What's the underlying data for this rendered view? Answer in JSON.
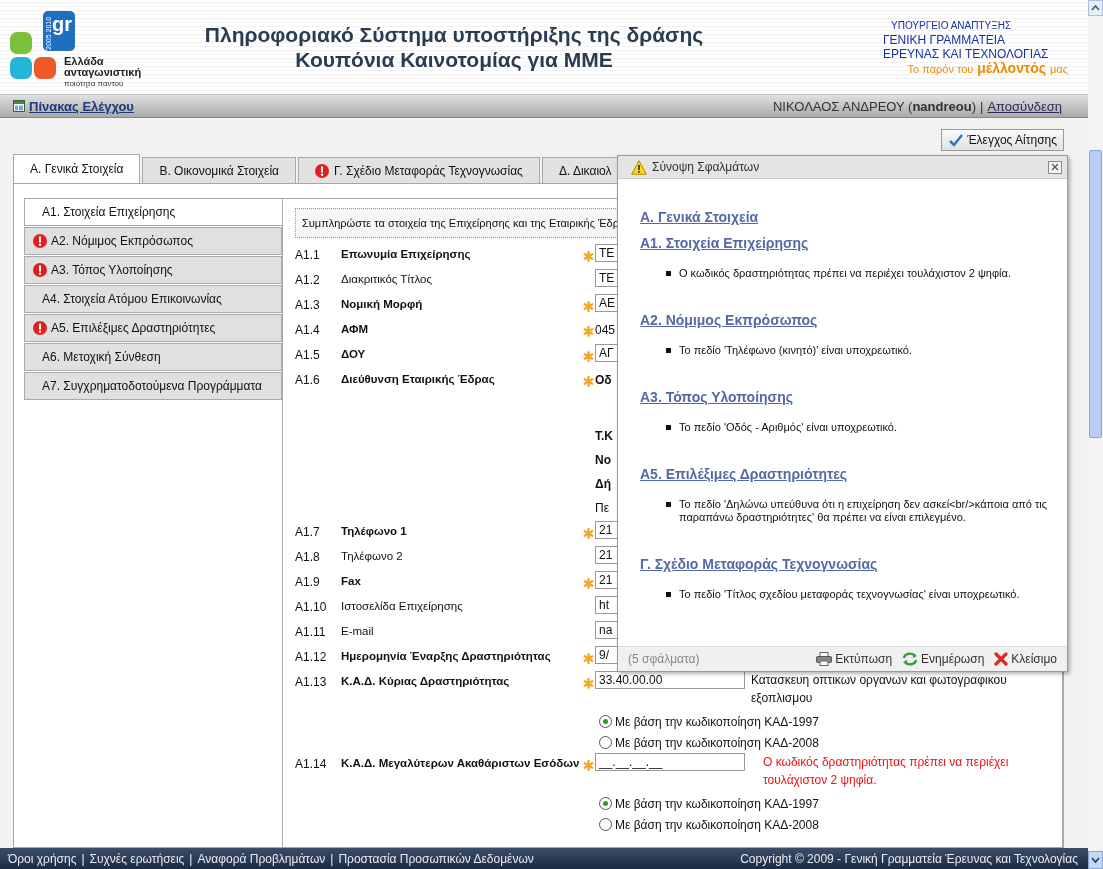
{
  "header": {
    "logo": {
      "mark": "gr",
      "years": "2005 2010",
      "lines": [
        "Ελλάδα",
        "ανταγωνιστική"
      ],
      "tagline": "ποιότητα παντού"
    },
    "title_lines": [
      "Πληροφοριακό Σύστημα υποστήριξης της δράσης",
      "Κουπόνια Καινοτομίας για ΜΜΕ"
    ],
    "ministry_lines": [
      "ΥΠΟΥΡΓΕΙΟ ΑΝΑΠΤΥΞΗΣ",
      "ΓΕΝΙΚΗ ΓΡΑΜΜΑΤΕΙΑ",
      "ΕΡΕΥΝΑΣ ΚΑΙ ΤΕΧΝΟΛΟΓΙΑΣ"
    ],
    "slogan": {
      "before": "Το παρόν του",
      "emphasis": "μέλλοντός",
      "after": "μας"
    }
  },
  "nav": {
    "dashboard_link": "Πίνακας Ελέγχου",
    "user": "ΝΙΚΟΛΑΟΣ ΑΝΔΡΕΟΥ (**nandreou**)",
    "separator": "|",
    "logout_link": "Αποσύνδεση"
  },
  "check_button": "Έλεγχος Αίτησης",
  "tabs": [
    {
      "label": "Α. Γενικά Στοιχεία",
      "selected": true,
      "error": false
    },
    {
      "label": "Β. Οικονομικά Στοιχεία",
      "selected": false,
      "error": false
    },
    {
      "label": "Γ. Σχέδιο Μεταφοράς Τεχνογνωσίας",
      "selected": false,
      "error": true
    },
    {
      "label": "Δ. Δικαιολ",
      "selected": false,
      "error": false
    }
  ],
  "sidebar": {
    "items": [
      {
        "label": "Α1. Στοιχεία Επιχείρησης",
        "selected": true,
        "error": false
      },
      {
        "label": "Α2. Νόμιμος Εκπρόσωπος",
        "selected": false,
        "error": true
      },
      {
        "label": "Α3. Τόπος Υλοποίησης",
        "selected": false,
        "error": true
      },
      {
        "label": "Α4. Στοιχεία Ατόμου Επικοινωνίας",
        "selected": false,
        "error": false
      },
      {
        "label": "Α5. Επιλέξιμες Δραστηριότητες",
        "selected": false,
        "error": true
      },
      {
        "label": "Α6. Μετοχική Σύνθεση",
        "selected": false,
        "error": false
      },
      {
        "label": "Α7. Συγχρηματοδοτούμενα Προγράμματα",
        "selected": false,
        "error": false
      }
    ]
  },
  "form": {
    "intro": "Συμπληρώστε τα στοιχεία της Επιχείρησης και της Εταιρικής Έδρ",
    "rows": [
      {
        "number": "Α1.1",
        "label": "Επωνυμία Επιχείρησης",
        "bold": true,
        "required": true,
        "kind": "input",
        "value": "ΤΕ"
      },
      {
        "number": "Α1.2",
        "label": "Διακριτικός Τίτλος",
        "bold": false,
        "required": false,
        "kind": "input",
        "value": "ΤΕ"
      },
      {
        "number": "Α1.3",
        "label": "Νομική Μορφή",
        "bold": true,
        "required": true,
        "kind": "input",
        "value": "ΑΕ"
      },
      {
        "number": "Α1.4",
        "label": "ΑΦΜ",
        "bold": true,
        "required": true,
        "kind": "plain",
        "value": "045"
      },
      {
        "number": "Α1.5",
        "label": "ΔΟΥ",
        "bold": true,
        "required": true,
        "kind": "input",
        "value": "ΑΓ"
      },
      {
        "number": "Α1.6",
        "label": "Διεύθυνση Εταιρικής Έδρας",
        "bold": true,
        "required": true,
        "kind": "address",
        "lines": [
          {
            "text": "Οδ",
            "bold": true
          },
          {
            "text": "Τ.Κ",
            "bold": true
          },
          {
            "text": "Νο",
            "bold": true
          },
          {
            "text": "Δή",
            "bold": true
          },
          {
            "text": "Πε",
            "bold": false
          }
        ]
      },
      {
        "number": "Α1.7",
        "label": "Τηλέφωνο 1",
        "bold": true,
        "required": true,
        "kind": "input",
        "value": "21"
      },
      {
        "number": "Α1.8",
        "label": "Τηλέφωνο 2",
        "bold": false,
        "required": false,
        "kind": "input",
        "value": "21"
      },
      {
        "number": "Α1.9",
        "label": "Fax",
        "bold": true,
        "required": true,
        "kind": "input",
        "value": "21"
      },
      {
        "number": "Α1.10",
        "label": "Ιστοσελίδα Επιχείρησης",
        "bold": false,
        "required": false,
        "kind": "input",
        "value": "ht"
      },
      {
        "number": "Α1.11",
        "label": "E-mail",
        "bold": false,
        "required": false,
        "kind": "input",
        "value": "na"
      },
      {
        "number": "Α1.12",
        "label": "Ημερομηνία Έναρξης Δραστηριότητας",
        "bold": true,
        "required": true,
        "kind": "input",
        "value": "9/"
      },
      {
        "number": "Α1.13",
        "label": "Κ.Α.Δ. Κύριας Δραστηριότητας",
        "bold": true,
        "required": true,
        "kind": "kad",
        "value": "33.40.00.00",
        "description": "Κατασκευη οπτικων οργανων και φωτογραφικου εξοπλισμου",
        "options": [
          {
            "label": "Με βάση την κωδικοποίηση ΚΑΔ-1997",
            "selected": true
          },
          {
            "label": "Με βάση την κωδικοποίηση ΚΑΔ-2008",
            "selected": false
          }
        ]
      },
      {
        "number": "Α1.14",
        "label": "Κ.Α.Δ. Μεγαλύτερων Ακαθάριστων Εσόδων",
        "bold": true,
        "required": true,
        "kind": "kad",
        "value": "__.__.__.__",
        "error": "Ο κωδικός δραστηριότητας πρέπει να περιέχει τουλάχιστον 2 ψηφία.",
        "options": [
          {
            "label": "Με βάση την κωδικοποίηση ΚΑΔ-1997",
            "selected": true
          },
          {
            "label": "Με βάση την κωδικοποίηση ΚΑΔ-2008",
            "selected": false
          }
        ]
      }
    ]
  },
  "error_dialog": {
    "title": "Σύνοψη Σφαλμάτων",
    "groups": [
      {
        "heading": "Α. Γενικά Στοιχεία"
      },
      {
        "heading": "Α1. Στοιχεία Επιχείρησης",
        "messages": [
          "Ο κωδικός δραστηριότητας πρέπει να περιέχει τουλάχιστον 2 ψηφία."
        ]
      },
      {
        "heading": "Α2. Νόμιμος Εκπρόσωπος",
        "messages": [
          "Το πεδίο 'Τηλέφωνο (κινητό)' είναι υποχρεωτικό."
        ]
      },
      {
        "heading": "Α3. Τόπος Υλοποίησης",
        "messages": [
          "Το πεδίο 'Οδός - Αριθμός' είναι υποχρεωτικό."
        ]
      },
      {
        "heading": "Α5. Επιλέξιμες Δραστηριότητες",
        "messages": [
          "Το πεδίο 'Δηλώνω υπεύθυνα ότι  η επιχείρηση δεν ασκεί<br/>κάποια από τις παραπάνω δραστηριότητες' θα πρέπει να είναι επιλεγμένο."
        ]
      },
      {
        "heading": "Γ. Σχέδιο Μεταφοράς Τεχνογνωσίας",
        "messages": [
          "Το πεδίο 'Τίτλος σχεδίου μεταφοράς τεχνογνωσίας' είναι υποχρεωτικό."
        ]
      }
    ],
    "count": "(5 σφάλματα)",
    "buttons": [
      {
        "kind": "print",
        "label": "Εκτύπωση"
      },
      {
        "kind": "refresh",
        "label": "Ενημέρωση"
      },
      {
        "kind": "close",
        "label": "Κλείσιμο"
      }
    ]
  },
  "footer": {
    "links": [
      "Όροι χρήσης",
      "Συχνές ερωτήσεις",
      "Αναφορά Προβλημάτων",
      "Προστασία Προσωπικών Δεδομένων"
    ],
    "separator": "|",
    "copyright": "Copyright © 2009 - Γενική Γραμματεία Έρευνας και Τεχνολογίας"
  }
}
